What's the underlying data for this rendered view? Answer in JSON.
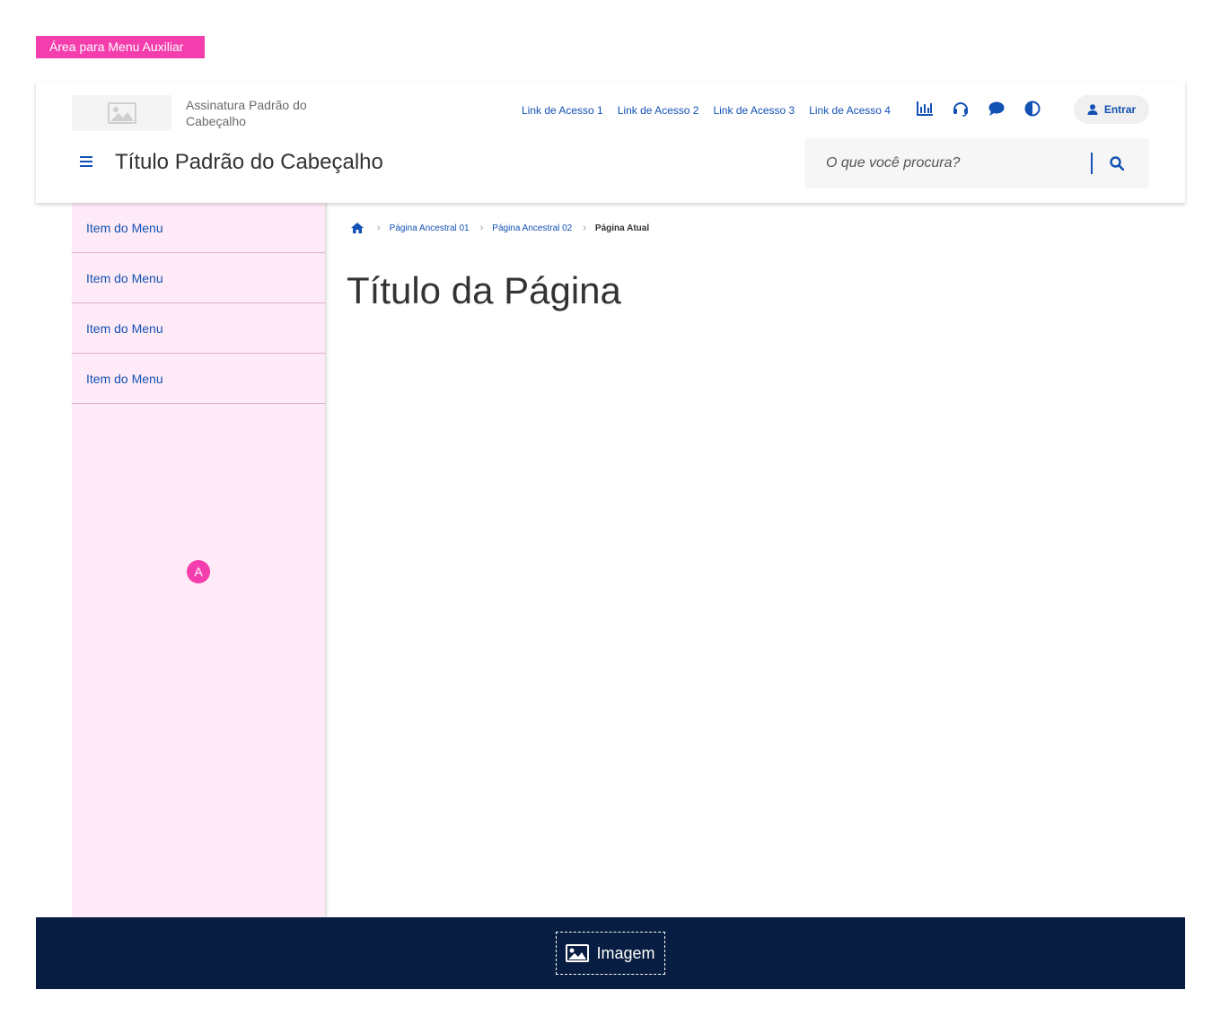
{
  "aux_menu": {
    "label": "Área para Menu Auxiliar"
  },
  "header": {
    "logo_icon": "image-icon",
    "signature": "Assinatura Padrão do Cabeçalho",
    "quick_links": [
      "Link de Acesso 1",
      "Link de Acesso 2",
      "Link de Acesso 3",
      "Link de Acesso 4"
    ],
    "function_icons": [
      "chart-bar-icon",
      "headset-icon",
      "comment-icon",
      "contrast-icon"
    ],
    "login_label": "Entrar",
    "title": "Título Padrão do Cabeçalho",
    "search": {
      "placeholder": "O que você procura?"
    }
  },
  "sidebar": {
    "items": [
      {
        "label": "Item do Menu"
      },
      {
        "label": "Item do Menu"
      },
      {
        "label": "Item do Menu"
      },
      {
        "label": "Item do Menu"
      }
    ],
    "marker": "A"
  },
  "breadcrumb": {
    "ancestors": [
      "Página Ancestral 01",
      "Página Ancestral 02"
    ],
    "current": "Página Atual"
  },
  "page": {
    "title": "Título da Página"
  },
  "footer": {
    "image_label": "Imagem"
  },
  "colors": {
    "primary": "#1351b4",
    "accent": "#f53ead",
    "sidebar_bg": "#ffebf7",
    "footer_bg": "#071d41"
  }
}
